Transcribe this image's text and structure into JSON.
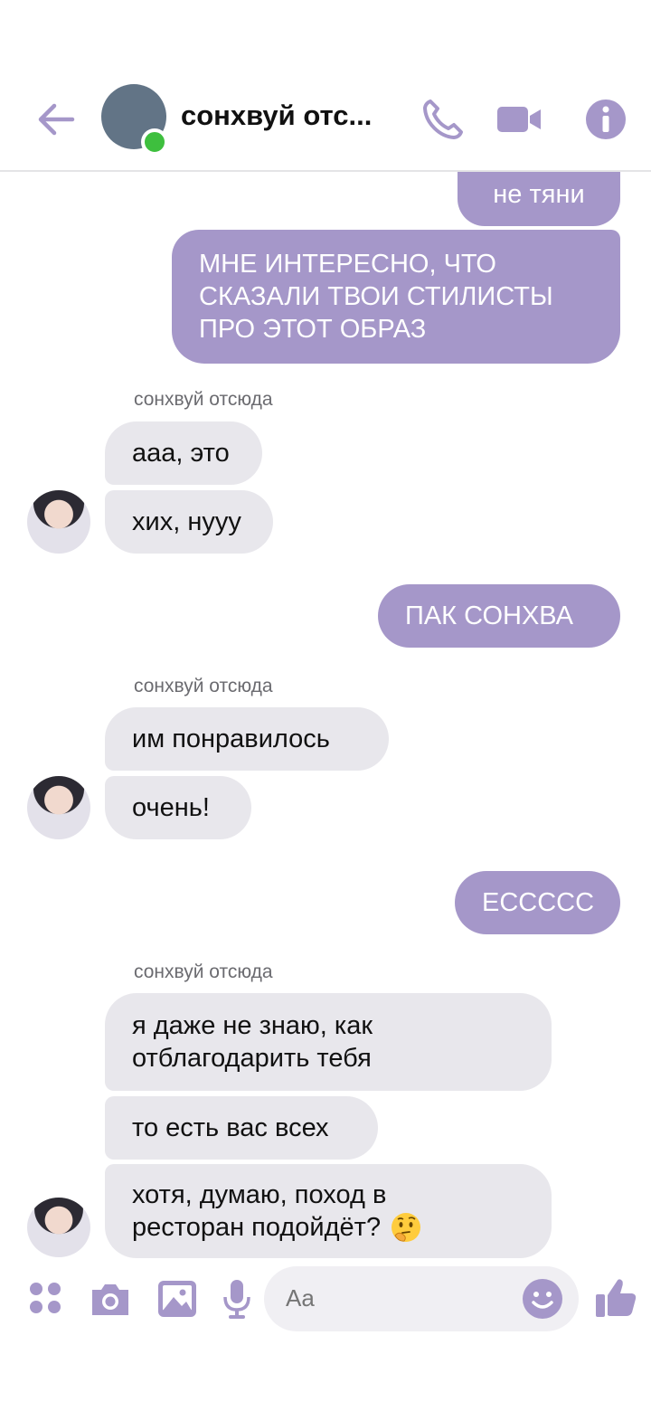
{
  "header": {
    "title": "сонхвуй отс...",
    "icons": [
      "back-arrow-icon",
      "phone-icon",
      "video-call-icon",
      "info-icon"
    ]
  },
  "colors": {
    "accent": "#a597c9",
    "incoming_bubble": "#e8e7ec",
    "online": "#3ebf3e"
  },
  "messages": [
    {
      "dir": "out",
      "text": "не тяни"
    },
    {
      "dir": "out",
      "lines": [
        "МНЕ ИНТЕРЕСНО, ЧТО",
        "СКАЗАЛИ ТВОИ СТИЛИСТЫ",
        "ПРО ЭТОТ ОБРАЗ"
      ]
    },
    {
      "dir": "in",
      "sender": "сонхвуй отсюда",
      "text": "ааа, это"
    },
    {
      "dir": "in",
      "text": "хих, нууу"
    },
    {
      "dir": "out",
      "text": "ПАК СОНХВА"
    },
    {
      "dir": "in",
      "sender": "сонхвуй отсюда",
      "text": "им понравилось"
    },
    {
      "dir": "in",
      "text": "очень!"
    },
    {
      "dir": "out",
      "text": "ЕССССС"
    },
    {
      "dir": "in",
      "sender": "сонхвуй отсюда",
      "lines": [
        "я даже не знаю, как",
        "отблагодарить тебя"
      ]
    },
    {
      "dir": "in",
      "text": "то есть вас всех"
    },
    {
      "dir": "in",
      "lines": [
        "хотя, думаю, поход в",
        "ресторан подойдёт?"
      ],
      "emoji": "thinking-face-icon"
    }
  ],
  "composer": {
    "placeholder": "Aa",
    "icons": [
      "apps-icon",
      "camera-icon",
      "image-icon",
      "microphone-icon",
      "emoji-icon",
      "thumbs-up-icon"
    ]
  }
}
